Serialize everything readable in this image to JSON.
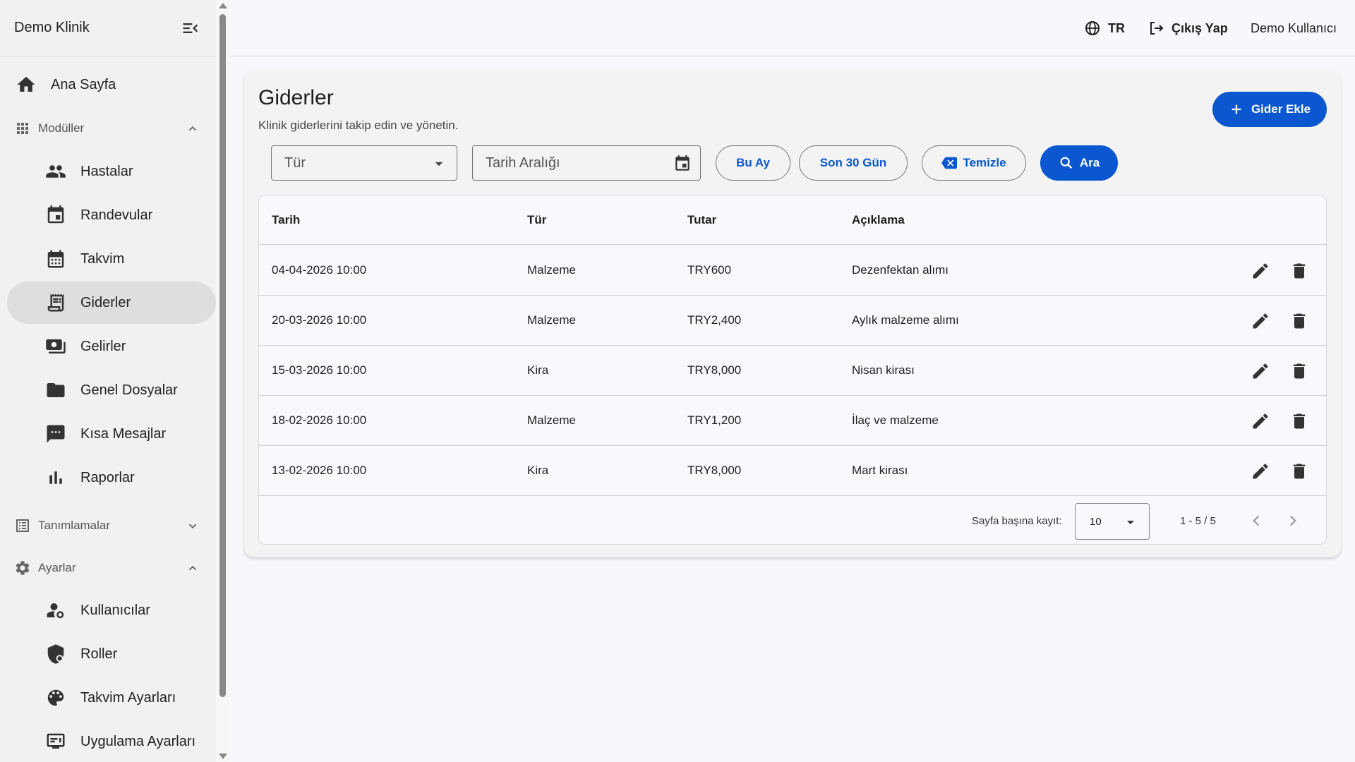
{
  "sidebar": {
    "brand": "Demo Klinik",
    "home": "Ana Sayfa",
    "groups": {
      "modules": "Modüller",
      "definitions": "Tanımlamalar",
      "settings": "Ayarlar"
    },
    "modules": [
      "Hastalar",
      "Randevular",
      "Takvim",
      "Giderler",
      "Gelirler",
      "Genel Dosyalar",
      "Kısa Mesajlar",
      "Raporlar"
    ],
    "settings_items": [
      "Kullanıcılar",
      "Roller",
      "Takvim Ayarları",
      "Uygulama Ayarları"
    ],
    "active": "Giderler"
  },
  "topbar": {
    "language": "TR",
    "logout": "Çıkış Yap",
    "user": "Demo Kullanıcı"
  },
  "page": {
    "title": "Giderler",
    "subtitle": "Klinik giderlerini takip edin ve yönetin.",
    "add_button": "Gider Ekle"
  },
  "filters": {
    "type_placeholder": "Tür",
    "date_placeholder": "Tarih Aralığı",
    "this_month": "Bu Ay",
    "last_30": "Son 30 Gün",
    "clear": "Temizle",
    "search": "Ara"
  },
  "table": {
    "columns": [
      "Tarih",
      "Tür",
      "Tutar",
      "Açıklama"
    ],
    "rows": [
      [
        "04-04-2026 10:00",
        "Malzeme",
        "TRY600",
        "Dezenfektan alımı"
      ],
      [
        "20-03-2026 10:00",
        "Malzeme",
        "TRY2,400",
        "Aylık malzeme alımı"
      ],
      [
        "15-03-2026 10:00",
        "Kira",
        "TRY8,000",
        "Nisan kirası"
      ],
      [
        "18-02-2026 10:00",
        "Malzeme",
        "TRY1,200",
        "İlaç ve malzeme"
      ],
      [
        "13-02-2026 10:00",
        "Kira",
        "TRY8,000",
        "Mart kirası"
      ]
    ]
  },
  "pagination": {
    "rows_per_page_label": "Sayfa başına kayıt:",
    "rows_per_page": "10",
    "range": "1 - 5 / 5"
  },
  "colors": {
    "primary": "#0b57d0",
    "sidebar_bg": "#f1f1f1",
    "active_bg": "#dedede"
  }
}
